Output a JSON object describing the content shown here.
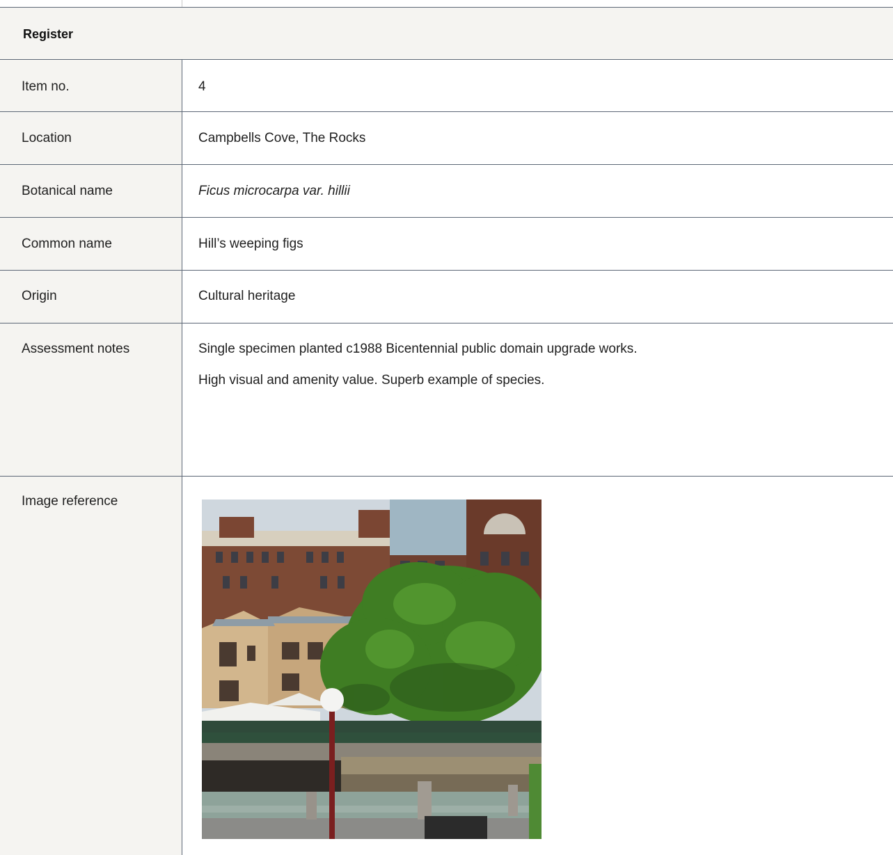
{
  "register": {
    "title": "Register"
  },
  "rows": [
    {
      "label": "Item no.",
      "value": "4"
    },
    {
      "label": "Location",
      "value": "Campbells Cove, The Rocks"
    },
    {
      "label": "Botanical name",
      "value": "Ficus microcarpa var. hillii"
    },
    {
      "label": "Common name",
      "value": "Hill’s weeping figs"
    },
    {
      "label": "Origin",
      "value": "Cultural heritage"
    },
    {
      "label": "Assessment notes",
      "lines": [
        "Single specimen planted c1988 Bicentennial public domain upgrade works.",
        "High visual and amenity value. Superb example of species."
      ]
    },
    {
      "label": "Image reference"
    }
  ]
}
